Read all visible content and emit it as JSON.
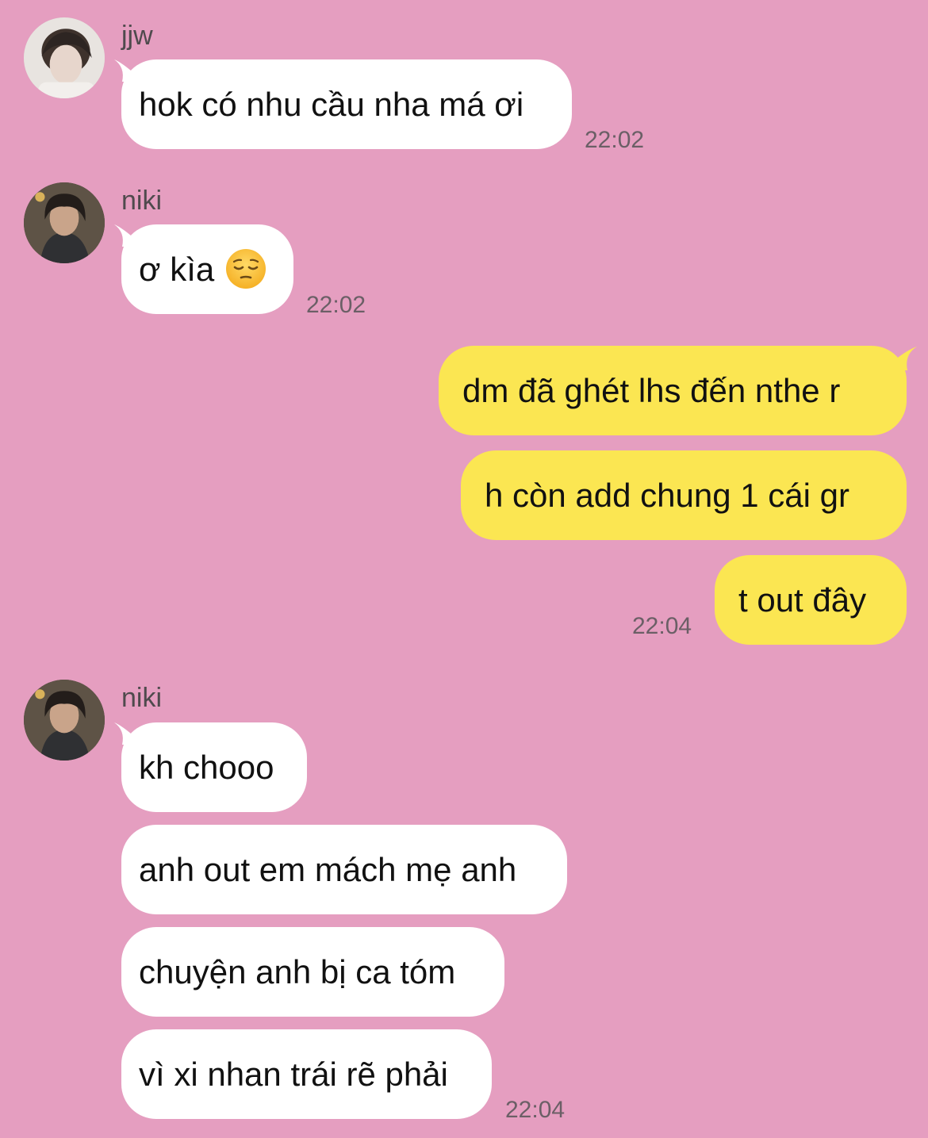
{
  "colors": {
    "background": "#e59ec0",
    "incoming_bubble": "#ffffff",
    "outgoing_bubble": "#fbe652",
    "timestamp": "#6b5f66"
  },
  "messages": {
    "g1": {
      "sender": "jjw",
      "texts": [
        "hok có nhu cầu nha má ơi"
      ],
      "time": "22:02"
    },
    "g2": {
      "sender": "niki",
      "texts": [
        "ơ kìa"
      ],
      "emoji": "pensive-face-icon",
      "time": "22:02"
    },
    "g3": {
      "texts": [
        "dm đã ghét lhs đến nthe r",
        "h còn add chung 1 cái gr",
        "t out đây"
      ],
      "time": "22:04"
    },
    "g4": {
      "sender": "niki",
      "texts": [
        "kh chooo",
        "anh out em mách mẹ anh",
        "chuyện anh bị ca tóm",
        "vì xi nhan trái rẽ phải"
      ],
      "time": "22:04"
    }
  }
}
